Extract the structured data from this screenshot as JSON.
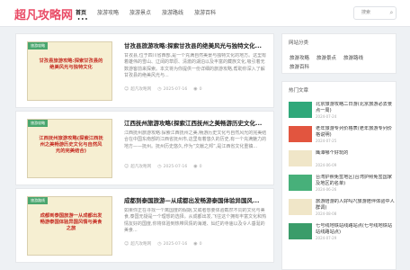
{
  "header": {
    "logo": "超凡攻略网",
    "nav": [
      {
        "label": "首页",
        "active": true
      },
      {
        "label": "旅游攻略",
        "active": false
      },
      {
        "label": "旅游景点",
        "active": false
      },
      {
        "label": "旅游路线",
        "active": false
      },
      {
        "label": "旅游百科",
        "active": false
      }
    ],
    "nav_active_dots": "•••",
    "search_placeholder": "搜索",
    "search_icon": "search-icon"
  },
  "posts": [
    {
      "tag": "旅游攻略",
      "thumb_text": "甘孜县旅游攻略:探索甘孜县的绝美风光与独特文化",
      "title": "甘孜县旅游攻略:探索甘孜县的绝美风光与独特文化...",
      "excerpt": "甘孜县,位于四川省西部,是一个充满自然美景与独特文化的地方。这里有着雄伟的雪山、辽阔的草原、清澈的湖泊以及丰富的藏族文化,吸引着无数游客前来探索。本文将为你提供一份详细的旅游攻略,帮助你深入了解甘孜县的绝美风光与...",
      "author": "超凡攻略网",
      "date": "2025-07-16",
      "views": "0"
    },
    {
      "tag": "旅游攻略",
      "thumb_text": "江西抚州旅游攻略(探索江西抚州之美畅游历史文化与自然风光的完美结合)",
      "title": "江西抚州旅游攻略(探索江西抚州之美畅游历史文化...",
      "excerpt": "江西抚州旅游攻略:探索江西抚州之美,畅游历史文化与自然风光的完美结合在中国东南部的江西省抚州市,这里有着悠久的历史,有一个充满魅力的地方——抚州。抚州历史悠久,作为“文献之邦”,是江西省文化重镇...",
      "author": "超凡攻略网",
      "date": "2025-07-16",
      "views": "0"
    },
    {
      "tag": "旅游路线",
      "thumb_text": "成都到泰国旅游一从成都出发畅游泰国体验异国风情与美食之旅",
      "title": "成都到泰国旅游—从成都出发畅游泰国体验异国风...",
      "excerpt": "如果你正在寻找一个离国度的假期,又或者想要体验截然不同的文化与美食,泰国无疑是一个理想的选择。从成都出发,飞往这个拥有丰富文化和热情友好的国度,你将体验到热带风情的海滩、灿烂的寺庙以及令人垂涎的美食...",
      "author": "超凡攻略网",
      "date": "2025-07-16",
      "views": "0"
    }
  ],
  "sidebar": {
    "categories_title": "网站分类",
    "categories": [
      "旅游攻略",
      "旅游景点",
      "旅游路线",
      "旅游百科"
    ],
    "hot_title": "热门文章",
    "hot": [
      {
        "title": "北京旅游攻略二日游(北京旅游必去景点一周)",
        "date": "2024-07-24",
        "color": "#2fa87a"
      },
      {
        "title": "老年旅游专列价格表(老年旅游专列价格说明)",
        "date": "2024-07-25",
        "color": "#e2553f"
      },
      {
        "title": "鹰潭哪个好玩的",
        "date": "2024-06-09",
        "color": "#f0e6c8"
      },
      {
        "title": "台湾护照免签地区(台湾护照免签国家及地区的名单)",
        "date": "2024-06-26",
        "color": "#47b07a"
      },
      {
        "title": "旅游陪游的人好吗?(旅游陪伴体验中人群调)",
        "date": "2024-08-08",
        "color": "#f0e6c8"
      },
      {
        "title": "七号线地铁站线路站点(七号线地铁站站线路站点)",
        "date": "2024-07-29",
        "color": "#3a9c6a"
      }
    ]
  }
}
